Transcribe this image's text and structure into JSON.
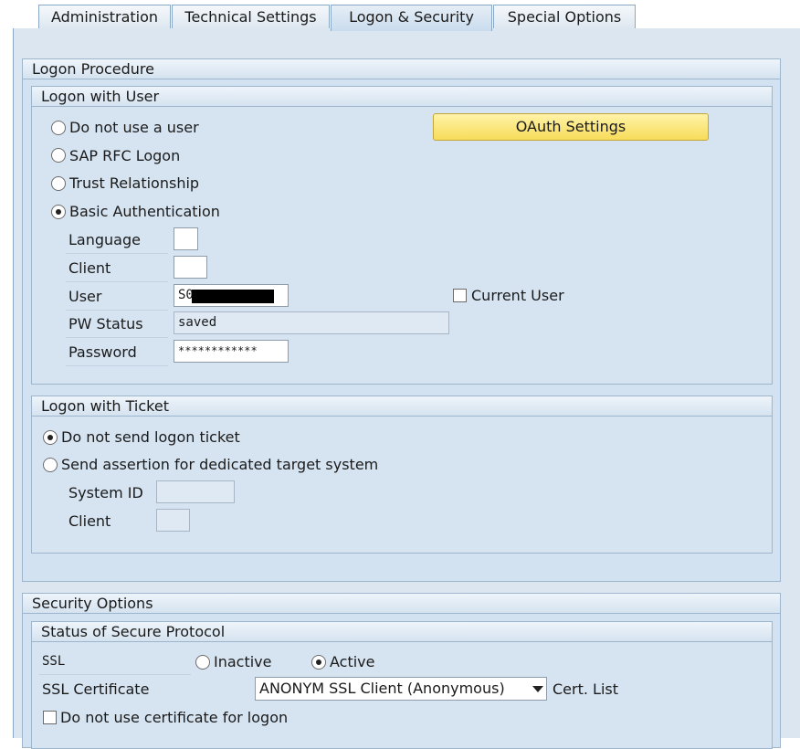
{
  "tabs": [
    {
      "label": "Administration",
      "active": false
    },
    {
      "label": "Technical Settings",
      "active": false
    },
    {
      "label": "Logon & Security",
      "active": true
    },
    {
      "label": "Special Options",
      "active": false
    }
  ],
  "logon_procedure": {
    "title": "Logon Procedure",
    "logon_with_user": {
      "title": "Logon with User",
      "options": [
        {
          "label": "Do not use a user",
          "selected": false
        },
        {
          "label": "SAP RFC Logon",
          "selected": false
        },
        {
          "label": "Trust Relationship",
          "selected": false
        },
        {
          "label": "Basic Authentication",
          "selected": true
        }
      ],
      "oauth_button": "OAuth Settings",
      "fields": {
        "language": {
          "label": "Language",
          "value": ""
        },
        "client": {
          "label": "Client",
          "value": ""
        },
        "user": {
          "label": "User",
          "value": "S0"
        },
        "pw_status": {
          "label": "PW Status",
          "value": "saved"
        },
        "password": {
          "label": "Password",
          "value": "************"
        }
      },
      "current_user": {
        "label": "Current User",
        "checked": false
      }
    },
    "logon_with_ticket": {
      "title": "Logon with Ticket",
      "options": [
        {
          "label": "Do not send logon ticket",
          "selected": true
        },
        {
          "label": "Send assertion for dedicated target system",
          "selected": false
        }
      ],
      "fields": {
        "system_id": {
          "label": "System ID",
          "value": ""
        },
        "client": {
          "label": "Client",
          "value": ""
        }
      }
    }
  },
  "security_options": {
    "title": "Security Options",
    "secure_protocol": {
      "title": "Status of Secure Protocol",
      "ssl_label": "SSL",
      "ssl_options": [
        {
          "label": "Inactive",
          "selected": false
        },
        {
          "label": "Active",
          "selected": true
        }
      ],
      "ssl_certificate_label": "SSL Certificate",
      "ssl_certificate_value": "ANONYM SSL Client (Anonymous)",
      "cert_list_label": "Cert. List",
      "no_cert_logon": {
        "label": "Do not use certificate for logon",
        "checked": false
      }
    }
  },
  "colors": {
    "oauth_button": "#f7dc5a",
    "background": "#dbe6f1",
    "group_border": "#9db5cd"
  }
}
